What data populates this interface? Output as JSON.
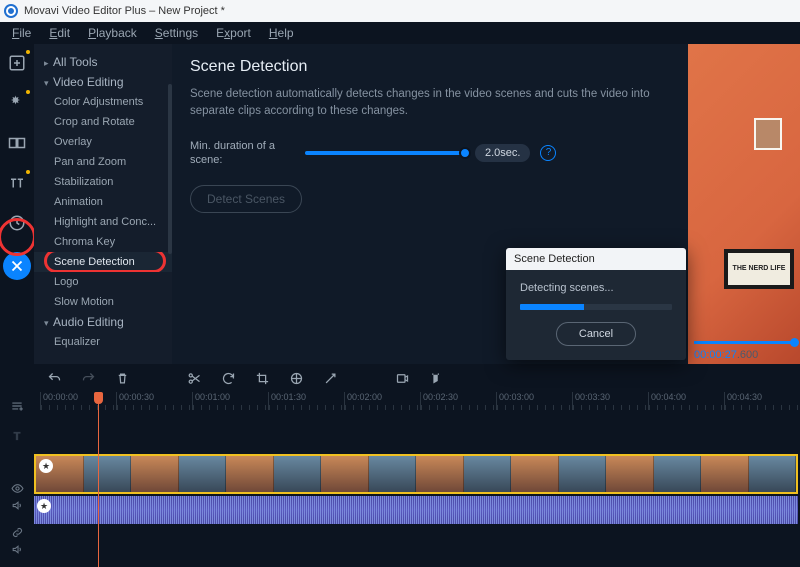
{
  "titlebar": {
    "title": "Movavi Video Editor Plus – New Project *"
  },
  "menubar": {
    "items": [
      "File",
      "Edit",
      "Playback",
      "Settings",
      "Export",
      "Help"
    ]
  },
  "sidebar": {
    "all_tools": "All Tools",
    "video_editing": "Video Editing",
    "video_items": [
      "Color Adjustments",
      "Crop and Rotate",
      "Overlay",
      "Pan and Zoom",
      "Stabilization",
      "Animation",
      "Highlight and Conc...",
      "Chroma Key",
      "Scene Detection",
      "Logo",
      "Slow Motion"
    ],
    "audio_editing": "Audio Editing",
    "audio_items": [
      "Equalizer"
    ]
  },
  "panel": {
    "title": "Scene Detection",
    "desc": "Scene detection automatically detects changes in the video scenes and cuts the video into separate clips according to these changes.",
    "min_label": "Min. duration of a scene:",
    "value": "2.0sec.",
    "detect_btn": "Detect Scenes"
  },
  "preview": {
    "sign_text": "THE\nNERD\nLIFE",
    "timecode": "00:00:27",
    "timecode_ms": ".600"
  },
  "ruler": [
    "00:00:00",
    "00:00:30",
    "00:01:00",
    "00:01:30",
    "00:02:00",
    "00:02:30",
    "00:03:00",
    "00:03:30",
    "00:04:00",
    "00:04:30"
  ],
  "dialog": {
    "title": "Scene Detection",
    "msg": "Detecting scenes...",
    "cancel": "Cancel"
  }
}
